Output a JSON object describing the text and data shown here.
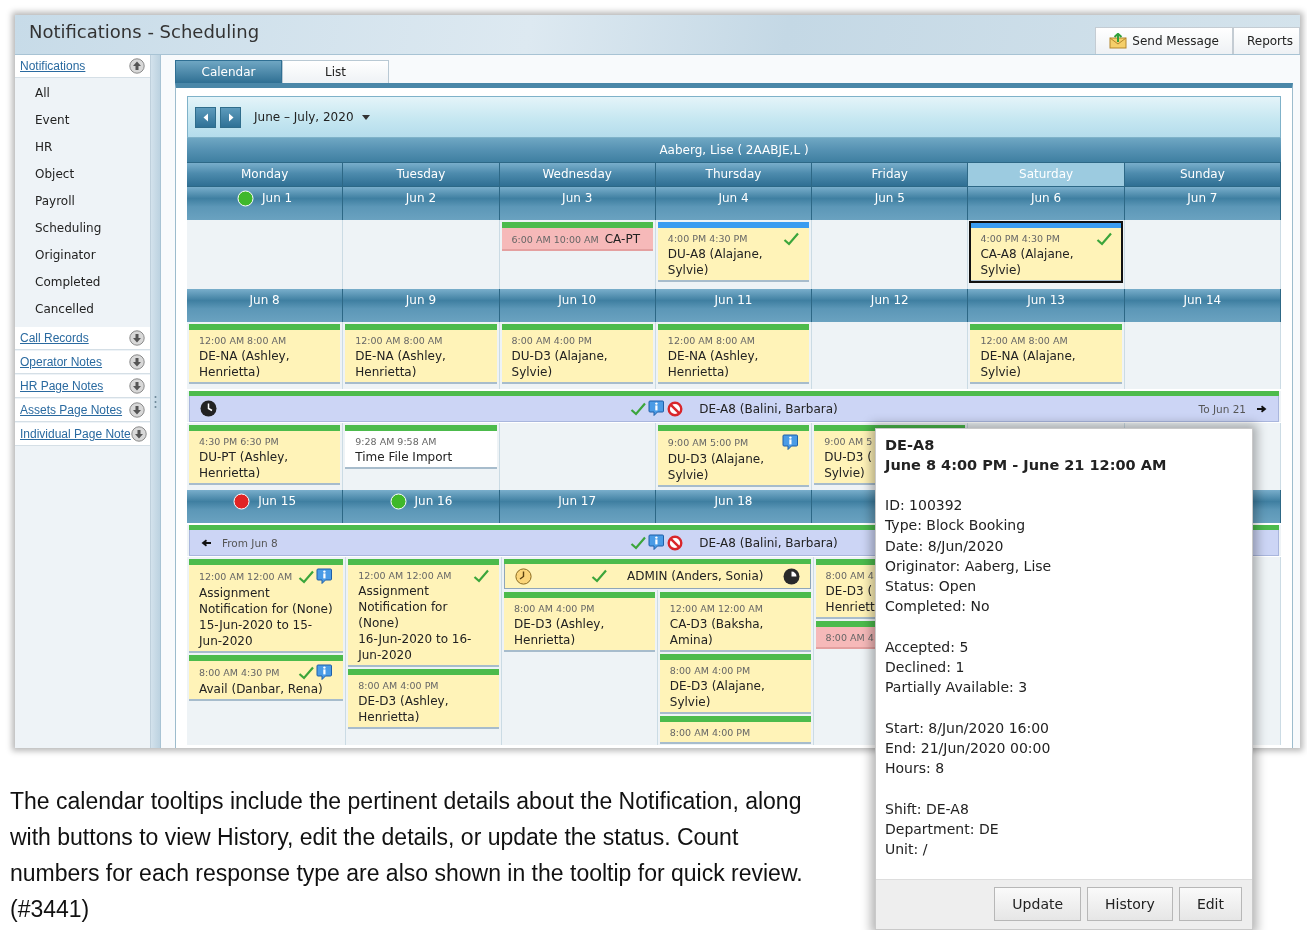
{
  "window": {
    "title": "Notifications - Scheduling"
  },
  "toolbar": [
    {
      "label": "Send Message",
      "kind": "mail"
    },
    {
      "label": "Reports",
      "kind": "plain"
    }
  ],
  "sidebar": {
    "sections": [
      {
        "label": "Notifications",
        "expanded": true,
        "items": [
          "All",
          "Event",
          "HR",
          "Object",
          "Payroll",
          "Scheduling",
          "Originator",
          "Completed",
          "Cancelled"
        ]
      },
      {
        "label": "Call Records",
        "expanded": false
      },
      {
        "label": "Operator Notes",
        "expanded": false
      },
      {
        "label": "HR Page Notes",
        "expanded": false
      },
      {
        "label": "Assets Page Notes",
        "expanded": false
      },
      {
        "label": "Individual Page Note",
        "expanded": false
      }
    ]
  },
  "tabs": [
    {
      "label": "Calendar",
      "selected": true
    },
    {
      "label": "List",
      "selected": false
    }
  ],
  "calendar": {
    "range": "June – July, 2020",
    "owner": "Aaberg, Lise ( 2AABJE,L )",
    "days": [
      {
        "name": "Monday",
        "selected": false
      },
      {
        "name": "Tuesday",
        "selected": false
      },
      {
        "name": "Wednesday",
        "selected": false
      },
      {
        "name": "Thursday",
        "selected": false
      },
      {
        "name": "Friday",
        "selected": false
      },
      {
        "name": "Saturday",
        "selected": true
      },
      {
        "name": "Sunday",
        "selected": false
      }
    ],
    "weeks": [
      {
        "dates": [
          {
            "label": "Jun 1",
            "color": "#3fb82a"
          },
          {
            "label": "Jun 2"
          },
          {
            "label": "Jun 3"
          },
          {
            "label": "Jun 4"
          },
          {
            "label": "Jun 5"
          },
          {
            "label": "Jun 6"
          },
          {
            "label": "Jun 7"
          }
        ],
        "bands": [
          {
            "kind": "days",
            "cells": [
              {},
              {},
              {
                "events": [
                  {
                    "kind": "alert",
                    "color": "#4cbb4c",
                    "time": "6:00 AM 10:00 AM",
                    "title": "CA-PT",
                    "selected": false
                  }
                ]
              },
              {
                "events": [
                  {
                    "kind": "shift",
                    "color": "#3a9cf0",
                    "time": "4:00 PM 4:30 PM",
                    "title": "DU-A8 (Alajane, Sylvie)",
                    "accepted": true,
                    "selected": false
                  }
                ]
              },
              {},
              {
                "events": [
                  {
                    "kind": "shift",
                    "color": "#3a9cf0",
                    "time": "4:00 PM 4:30 PM",
                    "title": "CA-A8 (Alajane, Sylvie)",
                    "accepted": true,
                    "selected": true
                  }
                ]
              },
              {}
            ]
          }
        ]
      },
      {
        "dates": [
          {
            "label": "Jun 8"
          },
          {
            "label": "Jun 9"
          },
          {
            "label": "Jun 10"
          },
          {
            "label": "Jun 11"
          },
          {
            "label": "Jun 12"
          },
          {
            "label": "Jun 13"
          },
          {
            "label": "Jun 14"
          }
        ],
        "bands": [
          {
            "kind": "days",
            "cells": [
              {
                "events": [
                  {
                    "kind": "shift",
                    "color": "#4cbb4c",
                    "time": "12:00 AM 8:00 AM",
                    "title": "DE-NA (Ashley, Henrietta)",
                    "selected": false
                  }
                ]
              },
              {
                "events": [
                  {
                    "kind": "shift",
                    "color": "#4cbb4c",
                    "time": "12:00 AM 8:00 AM",
                    "title": "DE-NA (Ashley, Henrietta)",
                    "selected": false
                  }
                ]
              },
              {
                "events": [
                  {
                    "kind": "shift",
                    "color": "#4cbb4c",
                    "time": "8:00 AM 4:00 PM",
                    "title": "DU-D3 (Alajane, Sylvie)",
                    "selected": false
                  }
                ]
              },
              {
                "events": [
                  {
                    "kind": "shift",
                    "color": "#4cbb4c",
                    "time": "12:00 AM 8:00 AM",
                    "title": "DE-NA (Ashley, Henrietta)",
                    "selected": false
                  }
                ]
              },
              {},
              {
                "events": [
                  {
                    "kind": "shift",
                    "color": "#4cbb4c",
                    "time": "12:00 AM 8:00 AM",
                    "title": "DE-NA (Alajane, Sylvie)",
                    "selected": false
                  }
                ]
              },
              {}
            ]
          },
          {
            "kind": "span",
            "color": "#4cbb4c",
            "accepted": true,
            "noted": true,
            "declined": true,
            "title": "DE-A8 (Balini, Barbara)",
            "end_label": "To Jun 21"
          },
          {
            "kind": "days",
            "cells": [
              {
                "events": [
                  {
                    "kind": "shift",
                    "color": "#4cbb4c",
                    "time": "4:30 PM 6:30 PM",
                    "title": "DU-PT (Ashley, Henrietta)",
                    "selected": false
                  }
                ]
              },
              {
                "events": [
                  {
                    "kind": "import",
                    "color": "#4cbb4c",
                    "time": "9:28 AM 9:58 AM",
                    "title": "Time File Import",
                    "selected": false
                  }
                ]
              },
              {},
              {
                "events": [
                  {
                    "kind": "shift",
                    "color": "#4cbb4c",
                    "time": "9:00 AM 5:00 PM",
                    "title": "DU-D3 (Alajane, Sylvie)",
                    "noted": true,
                    "selected": false
                  }
                ]
              },
              {
                "events": [
                  {
                    "kind": "shift",
                    "color": "#4cbb4c",
                    "time": "9:00 AM 5",
                    "title": "DU-D3 (",
                    "detail": "Sylvie)",
                    "selected": false
                  }
                ]
              },
              {},
              {}
            ]
          }
        ]
      },
      {
        "dates": [
          {
            "label": "Jun 15",
            "color": "#e02424"
          },
          {
            "label": "Jun 16",
            "color": "#3fb82a"
          },
          {
            "label": "Jun 17"
          },
          {
            "label": "Jun 18"
          }
        ],
        "bands": [
          {
            "kind": "span",
            "color": "#4cbb4c",
            "start_label": "From Jun 8",
            "accepted": true,
            "noted": true,
            "declined": true,
            "title": "DE-A8 (Balini, Barbara)"
          },
          {
            "kind": "days",
            "cells": [
              {
                "events": [
                  {
                    "kind": "shift",
                    "color": "#4cbb4c",
                    "time": "12:00 AM 12:00 AM",
                    "accepted": true,
                    "noted": true,
                    "title": "Assignment Notification for (None)",
                    "detail": "15-Jun-2020 to 15-Jun-2020",
                    "selected": false
                  },
                  {
                    "kind": "shift",
                    "color": "#4cbb4c",
                    "time": "8:00 AM 4:30 PM",
                    "accepted": true,
                    "noted": true,
                    "title": "Avail (Danbar, Rena)",
                    "selected": false
                  }
                ]
              },
              {
                "events": [
                  {
                    "kind": "shift",
                    "color": "#4cbb4c",
                    "time": "12:00 AM 12:00 AM",
                    "accepted": true,
                    "title": "Assignment Notification for (None)",
                    "detail": "16-Jun-2020 to 16-Jun-2020",
                    "selected": false
                  },
                  {
                    "kind": "shift",
                    "color": "#4cbb4c",
                    "time": "8:00 AM 4:00 PM",
                    "title": "DE-D3 (Ashley, Henrietta)",
                    "selected": false
                  }
                ]
              },
              {
                "bar": {
                  "color": "#4cbb4c",
                  "accepted": true,
                  "title": "ADMIN (Anders, Sonia)",
                  "wide": true
                },
                "events": [
                  {
                    "kind": "shift",
                    "color": "#4cbb4c",
                    "time": "8:00 AM 4:00 PM",
                    "title": "DE-D3 (Ashley, Henrietta)",
                    "selected": false
                  }
                ]
              },
              {
                "events": [
                  {
                    "kind": "shift",
                    "color": "#4cbb4c",
                    "time": "12:00 AM 12:00 AM",
                    "title": "CA-D3 (Baksha, Amina)",
                    "selected": false
                  },
                  {
                    "kind": "shift",
                    "color": "#4cbb4c",
                    "time": "8:00 AM 4:00 PM",
                    "title": "DE-D3 (Alajane, Sylvie)",
                    "selected": false
                  },
                  {
                    "kind": "shift",
                    "color": "#4cbb4c",
                    "time": "8:00 AM 4:00 PM",
                    "selected": false
                  }
                ]
              },
              {
                "events": [
                  {
                    "kind": "shift",
                    "color": "#4cbb4c",
                    "time": "8:00 AM 4",
                    "title": "DE-D3 (",
                    "detail": "Henriett",
                    "selected": false
                  },
                  {
                    "kind": "alert",
                    "color": "#4cbb4c",
                    "time": "8:00 AM 4",
                    "selected": false
                  }
                ]
              },
              {},
              {}
            ]
          }
        ]
      }
    ]
  },
  "tooltip": {
    "title": "DE-A8",
    "subtitle": "June 8 4:00 PM - June 21 12:00 AM",
    "groups": [
      [
        "ID: 100392",
        "Type: Block Booking",
        "Date: 8/Jun/2020",
        "Originator: Aaberg, Lise",
        "Status: Open",
        "Completed: No"
      ],
      [
        "Accepted: 5",
        "Declined: 1",
        "Partially Available: 3"
      ],
      [
        "Start: 8/Jun/2020 16:00",
        "End: 21/Jun/2020 00:00",
        "Hours: 8"
      ],
      [
        "Shift: DE-A8",
        "Department: DE",
        "Unit: /"
      ]
    ],
    "buttons": [
      "Update",
      "History",
      "Edit"
    ]
  },
  "caption": "The calendar tooltips include the pertinent details about the Notification, along with buttons to view History, edit the details, or update the status. Count numbers for each response type are also shown in the tooltip for quick review. (#3441)"
}
